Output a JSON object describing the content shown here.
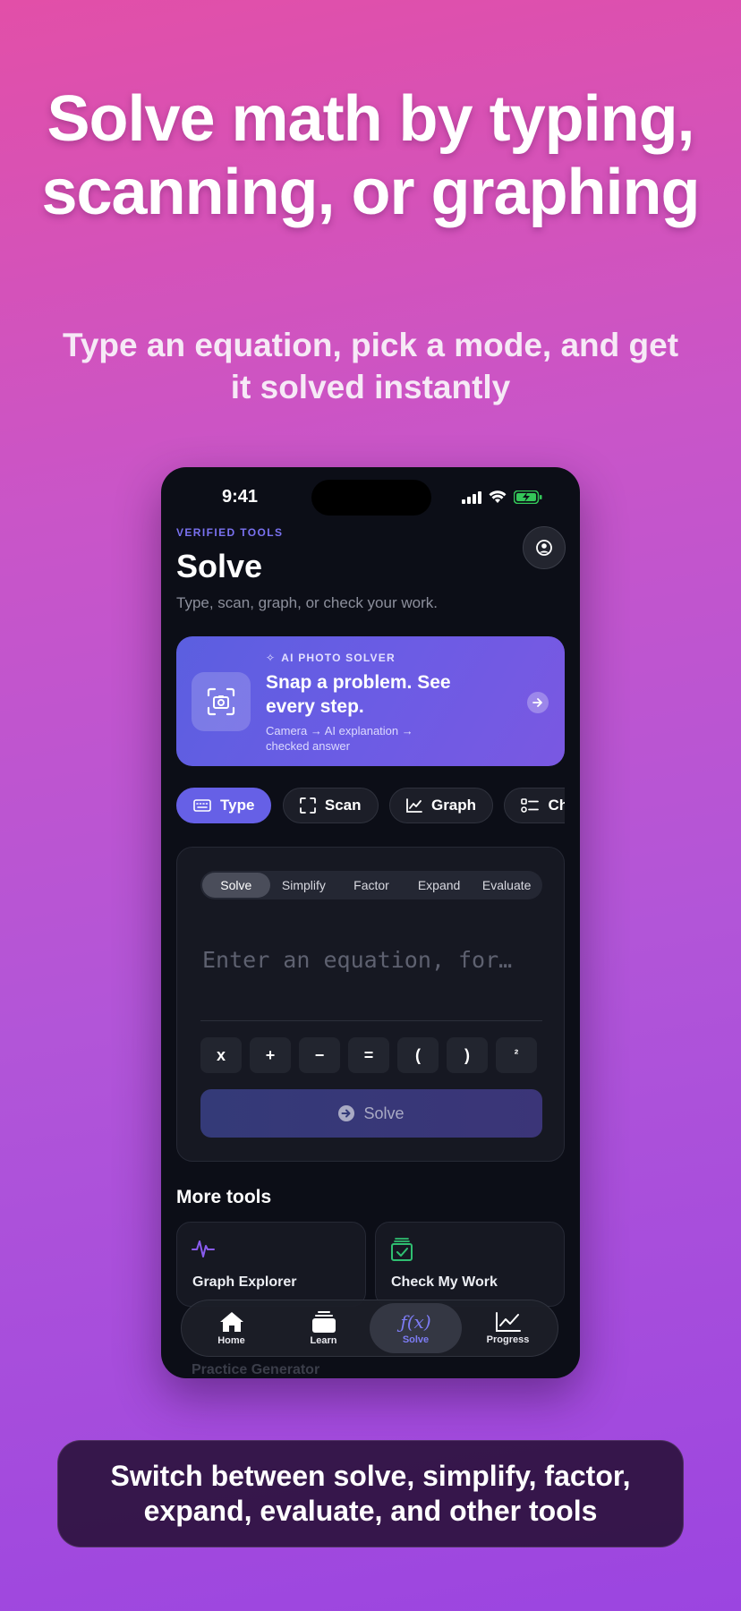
{
  "promo": {
    "headline": "Solve math by typing, scanning, or graphing",
    "subhead": "Type an equation, pick a mode, and get it solved instantly",
    "caption": "Switch between solve, simplify, factor, expand, evaluate, and other tools"
  },
  "status_bar": {
    "time": "9:41",
    "icons": [
      "signal-icon",
      "wifi-icon",
      "battery-charging-icon"
    ]
  },
  "header": {
    "eyebrow": "VERIFIED TOOLS",
    "title": "Solve",
    "subtitle": "Type, scan, graph, or check your work.",
    "profile_icon": "profile-icon"
  },
  "ai_card": {
    "eyebrow": "AI PHOTO SOLVER",
    "title": "Snap a problem. See every step.",
    "subtitle": "Camera → AI explanation → checked answer",
    "icon": "camera-icon"
  },
  "modes": [
    {
      "label": "Type",
      "icon": "keyboard-icon",
      "active": true
    },
    {
      "label": "Scan",
      "icon": "scan-icon",
      "active": false
    },
    {
      "label": "Graph",
      "icon": "graph-icon",
      "active": false
    },
    {
      "label": "Check Work",
      "icon": "checklist-icon",
      "active": false
    }
  ],
  "solver": {
    "operations": [
      "Solve",
      "Simplify",
      "Factor",
      "Expand",
      "Evaluate"
    ],
    "active_operation": "Solve",
    "input_placeholder": "Enter an equation, for…",
    "input_value": "",
    "keys": [
      "x",
      "+",
      "−",
      "=",
      "(",
      ")",
      "²"
    ],
    "solve_label": "Solve"
  },
  "more_tools": {
    "title": "More tools",
    "items": [
      {
        "label": "Graph Explorer",
        "icon": "waveform-icon"
      },
      {
        "label": "Check My Work",
        "icon": "check-clipboard-icon"
      },
      {
        "label": "Practice Generator",
        "icon": "practice-icon"
      }
    ]
  },
  "tab_bar": [
    {
      "label": "Home",
      "icon": "home-icon",
      "active": false
    },
    {
      "label": "Learn",
      "icon": "stack-icon",
      "active": false
    },
    {
      "label": "Solve",
      "icon": "function-icon",
      "glyph": "ƒ(x)",
      "active": true
    },
    {
      "label": "Progress",
      "icon": "chart-icon",
      "active": false
    }
  ],
  "colors": {
    "accent": "#6660e6",
    "background_top": "#e24fa8",
    "background_bottom": "#9b45e0",
    "phone_bg": "#0c0e17"
  }
}
